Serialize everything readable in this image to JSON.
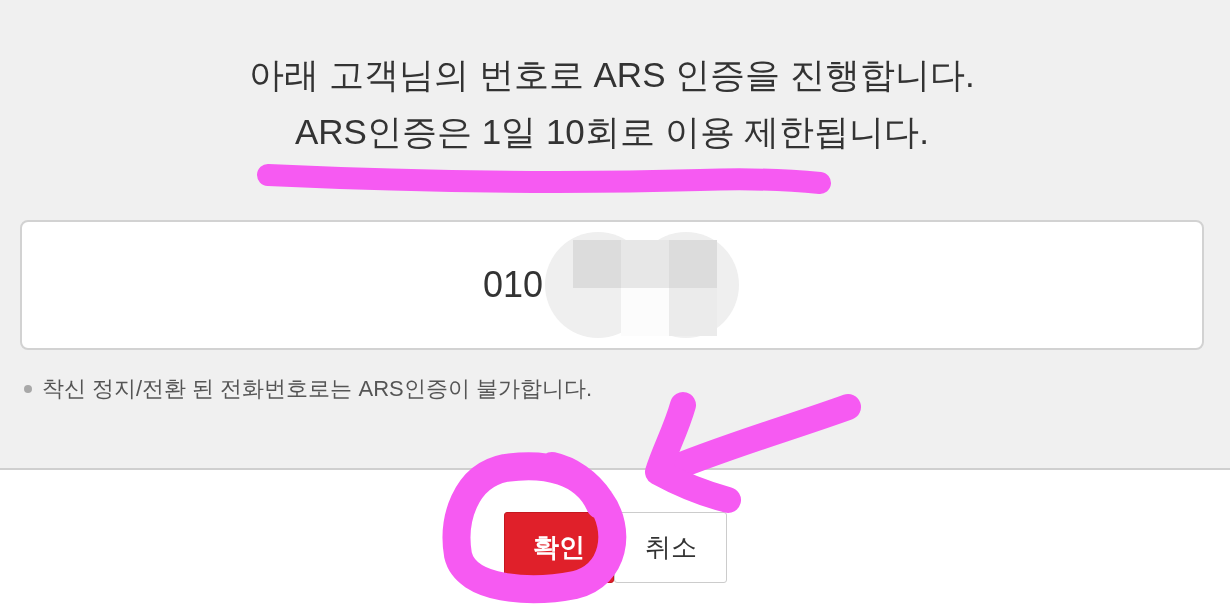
{
  "notice": {
    "lines": [
      "아래 고객님의 번호로 ARS 인증을 진행합니다.",
      "ARS인증은 1일 10회로 이용 제한됩니다."
    ]
  },
  "phone_field": {
    "value": "010",
    "redacted": true
  },
  "notes": [
    "착신 정지/전환 된 전화번호로는 ARS인증이 불가합니다."
  ],
  "buttons": [
    {
      "label": "확인",
      "kind": "primary"
    },
    {
      "label": "취소",
      "kind": "secondary"
    }
  ],
  "annotations": [
    {
      "kind": "underline"
    },
    {
      "kind": "circle"
    },
    {
      "kind": "arrow"
    }
  ]
}
